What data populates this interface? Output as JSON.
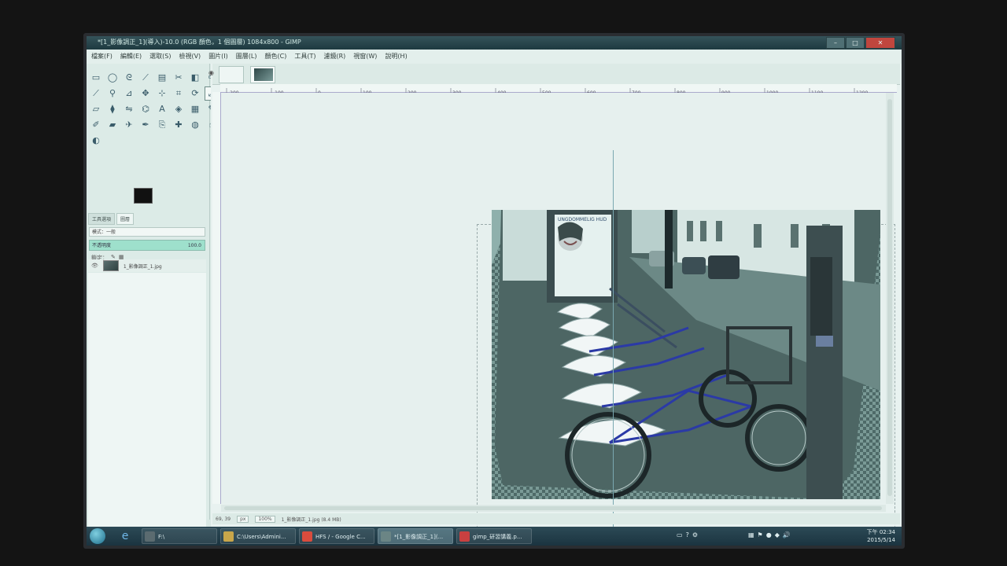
{
  "window": {
    "title": "*[1_影像調正_1](導入)-10.0 (RGB 顏色，1 個圖層) 1084x800 - GIMP",
    "buttons": [
      "–",
      "□",
      "✕"
    ]
  },
  "menu": [
    "檔案(F)",
    "編輯(E)",
    "選取(S)",
    "檢視(V)",
    "圖片(I)",
    "圖層(L)",
    "顏色(C)",
    "工具(T)",
    "濾鏡(R)",
    "視窗(W)",
    "說明(H)"
  ],
  "toolbox": {
    "tools": [
      {
        "icon": "rect-select-icon",
        "glyph": "▭"
      },
      {
        "icon": "ellipse-select-icon",
        "glyph": "◯"
      },
      {
        "icon": "lasso-icon",
        "glyph": "ᘓ"
      },
      {
        "icon": "fuzzy-select-icon",
        "glyph": "⟋"
      },
      {
        "icon": "color-select-icon",
        "glyph": "▤"
      },
      {
        "icon": "scissors-icon",
        "glyph": "✂"
      },
      {
        "icon": "foreground-select-icon",
        "glyph": "◧"
      },
      {
        "icon": "paths-icon",
        "glyph": "✑"
      },
      {
        "icon": "color-picker-icon",
        "glyph": "⟋"
      },
      {
        "icon": "zoom-icon",
        "glyph": "⚲"
      },
      {
        "icon": "measure-icon",
        "glyph": "⊿"
      },
      {
        "icon": "move-icon",
        "glyph": "✥"
      },
      {
        "icon": "align-icon",
        "glyph": "⊹"
      },
      {
        "icon": "crop-icon",
        "glyph": "⌗"
      },
      {
        "icon": "rotate-icon",
        "glyph": "⟳"
      },
      {
        "icon": "scale-icon",
        "glyph": "⤢"
      },
      {
        "icon": "shear-icon",
        "glyph": "▱"
      },
      {
        "icon": "perspective-icon",
        "glyph": "⧫"
      },
      {
        "icon": "flip-icon",
        "glyph": "⇋"
      },
      {
        "icon": "cage-icon",
        "glyph": "⌬"
      },
      {
        "icon": "text-icon",
        "glyph": "A"
      },
      {
        "icon": "bucket-fill-icon",
        "glyph": "◈"
      },
      {
        "icon": "blend-icon",
        "glyph": "▦"
      },
      {
        "icon": "pencil-icon",
        "glyph": "✎"
      },
      {
        "icon": "paintbrush-icon",
        "glyph": "✐"
      },
      {
        "icon": "eraser-icon",
        "glyph": "▰"
      },
      {
        "icon": "airbrush-icon",
        "glyph": "✈"
      },
      {
        "icon": "ink-icon",
        "glyph": "✒"
      },
      {
        "icon": "clone-icon",
        "glyph": "⎘"
      },
      {
        "icon": "heal-icon",
        "glyph": "✚"
      },
      {
        "icon": "blur-icon",
        "glyph": "◍"
      },
      {
        "icon": "smudge-icon",
        "glyph": "☝"
      },
      {
        "icon": "dodge-icon",
        "glyph": "◐"
      }
    ],
    "tabs": [
      "工具選項",
      "圖層"
    ],
    "mode_label": "模式：一般",
    "opacity_label": "不透明度",
    "opacity_value": "100.0",
    "lock_label": "鎖定：",
    "layer_name": "1_影像調正_1.jpg"
  },
  "image_window": {
    "ruler_labels": [
      "-200",
      "-100",
      "0",
      "100",
      "200",
      "300",
      "400",
      "500",
      "600",
      "700",
      "800",
      "900",
      "1000",
      "1100",
      "1200"
    ],
    "status": {
      "coords": "69, 39",
      "unit": "px",
      "zoom": "100%",
      "file_info": "1_影像調正_1.jpg (8.4 MB)"
    }
  },
  "taskbar": {
    "tasks": [
      {
        "label": "F:\\",
        "color": "#5b6b70"
      },
      {
        "label": "C:\\Users\\Admini...",
        "color": "#c9a64a"
      },
      {
        "label": "HFS / - Google C...",
        "color": "#d94c3d"
      },
      {
        "label": "*[1_影像調正_1](...",
        "color": "#6b8585"
      },
      {
        "label": "gimp_研習講義.p...",
        "color": "#c94040"
      }
    ],
    "clock_time": "下午 02:34",
    "clock_date": "2015/5/14"
  }
}
